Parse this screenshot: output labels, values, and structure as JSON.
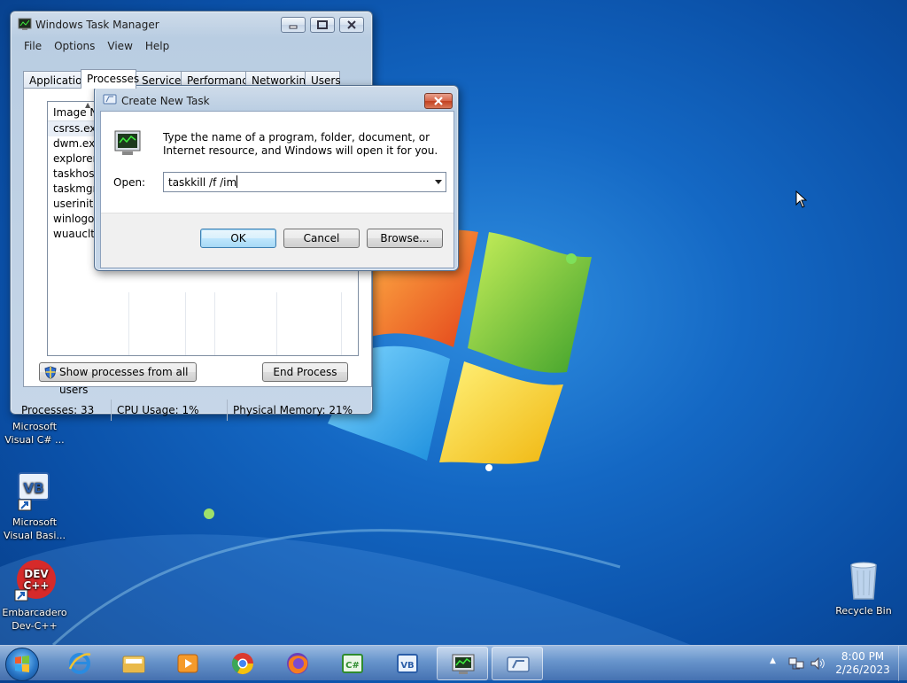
{
  "desktop": {
    "icons": [
      {
        "label": "Microsoft\nVisual C# ...",
        "icon": "visual-csharp-icon"
      },
      {
        "label": "Microsoft\nVisual Basi...",
        "icon": "visual-basic-icon"
      },
      {
        "label": "Embarcadero\nDev-C++",
        "icon": "dev-cpp-icon"
      },
      {
        "label": "Recycle Bin",
        "icon": "recycle-bin-icon"
      }
    ]
  },
  "task_manager": {
    "title": "Windows Task Manager",
    "menu": [
      "File",
      "Options",
      "View",
      "Help"
    ],
    "tabs": [
      "Applications",
      "Processes",
      "Services",
      "Performance",
      "Networking",
      "Users"
    ],
    "active_tab": "Processes",
    "column_header": "Image Name",
    "processes": [
      "csrss.exe",
      "dwm.exe",
      "explorer.exe",
      "taskhost.exe",
      "taskmgr.exe",
      "userinit.exe",
      "winlogon.exe",
      "wuauclt.exe"
    ],
    "show_all_button": "Show processes from all users",
    "end_process_button": "End Process",
    "status": {
      "processes": "Processes: 33",
      "cpu": "CPU Usage: 1%",
      "memory": "Physical Memory: 21%"
    }
  },
  "create_task_dialog": {
    "title": "Create New Task",
    "message": "Type the name of a program, folder, document, or Internet resource, and Windows will open it for you.",
    "open_label": "Open:",
    "open_value": "taskkill /f /im",
    "ok": "OK",
    "cancel": "Cancel",
    "browse": "Browse..."
  },
  "taskbar": {
    "pinned": [
      "internet-explorer-icon",
      "explorer-folder-icon",
      "media-player-icon",
      "chrome-icon",
      "firefox-icon",
      "csharp-icon",
      "vb-icon",
      "task-manager-icon",
      "run-dialog-icon"
    ],
    "active": [
      "task-manager-icon",
      "run-dialog-icon"
    ],
    "time": "8:00 PM",
    "date": "2/26/2023"
  },
  "colors": {
    "desktop": "#1468c4",
    "title_glass": "#c6d6e8",
    "close_button": "#c2411f"
  }
}
